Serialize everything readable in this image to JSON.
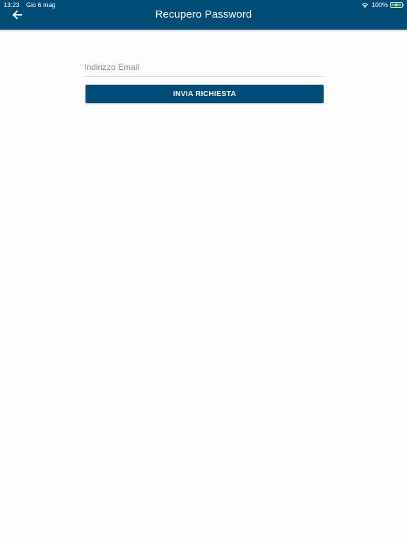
{
  "status_bar": {
    "time": "13:23",
    "date": "Gio 6 mag",
    "battery_percent": "100%",
    "battery_level": 1.0,
    "battery_color": "#34c759"
  },
  "header": {
    "title": "Recupero Password",
    "back_icon": "arrow-left-icon",
    "background_color": "#004d77"
  },
  "form": {
    "email_placeholder": "Indirizzo Email",
    "email_value": "",
    "submit_label": "INVIA RICHIESTA",
    "accent_color": "#004d77"
  }
}
